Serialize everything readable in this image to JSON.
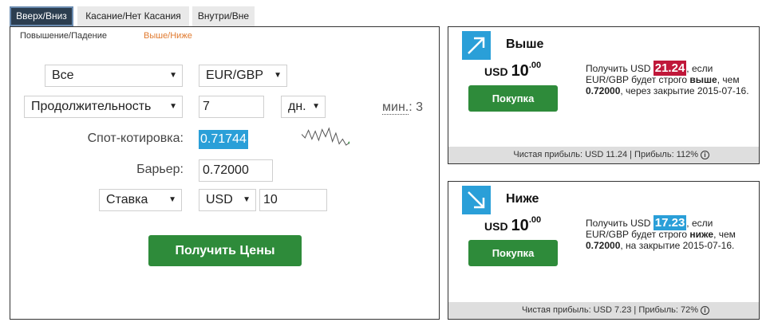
{
  "tabs": [
    {
      "label": "Вверх/Вниз",
      "active": true
    },
    {
      "label": "Касание/Нет Касания",
      "active": false
    },
    {
      "label": "Внутри/Вне",
      "active": false
    }
  ],
  "subtabs": [
    {
      "label": "Повышение/Падение"
    },
    {
      "label": "Выше/Ниже",
      "color": "#e07a2f"
    }
  ],
  "form": {
    "market_select": "Все",
    "symbol_select": "EUR/GBP",
    "duration_select": "Продолжительность",
    "duration_value": "7",
    "duration_unit": "дн.",
    "min_prefix": "мин.",
    "min_value": ": 3",
    "spot_label": "Спот-котировка:",
    "spot_value": "0.71744",
    "barrier_label": "Барьер:",
    "barrier_value": "0.72000",
    "basis_select": "Ставка",
    "currency_select": "USD",
    "amount_value": "10",
    "get_prices_button": "Получить Цены"
  },
  "sparkline": {
    "points": [
      0.55,
      0.4,
      0.72,
      0.35,
      0.68,
      0.3,
      0.75,
      0.45,
      0.8,
      0.25,
      0.6,
      0.15,
      0.35,
      0.1,
      0.2
    ]
  },
  "cards": [
    {
      "title": "Выше",
      "currency": "USD",
      "price_int": "10",
      "price_dec": ".00",
      "buy_label": "Покупка",
      "desc_pre": "Получить USD ",
      "payout": "21.24",
      "payout_color": "#c0183a",
      "desc_mid": ", если EUR/GBP будет строго ",
      "direction": "выше",
      "desc_mid2": ", чем ",
      "barrier": "0.72000",
      "desc_post": ", через закрытие 2015-07-16.",
      "footer": "Чистая прибыль: USD 11.24 | Прибыль: 112%",
      "icon": "arrow-up-right-icon"
    },
    {
      "title": "Ниже",
      "currency": "USD",
      "price_int": "10",
      "price_dec": ".00",
      "buy_label": "Покупка",
      "desc_pre": "Получить USD ",
      "payout": "17.23",
      "payout_color": "#2a9fd8",
      "desc_mid": ", если EUR/GBP будет строго ",
      "direction": "ниже",
      "desc_mid2": ", чем ",
      "barrier": "0.72000",
      "desc_post": ", на закрытие 2015-07-16.",
      "footer": "Чистая прибыль: USD 7.23 | Прибыль: 72%",
      "icon": "arrow-down-right-icon"
    }
  ]
}
